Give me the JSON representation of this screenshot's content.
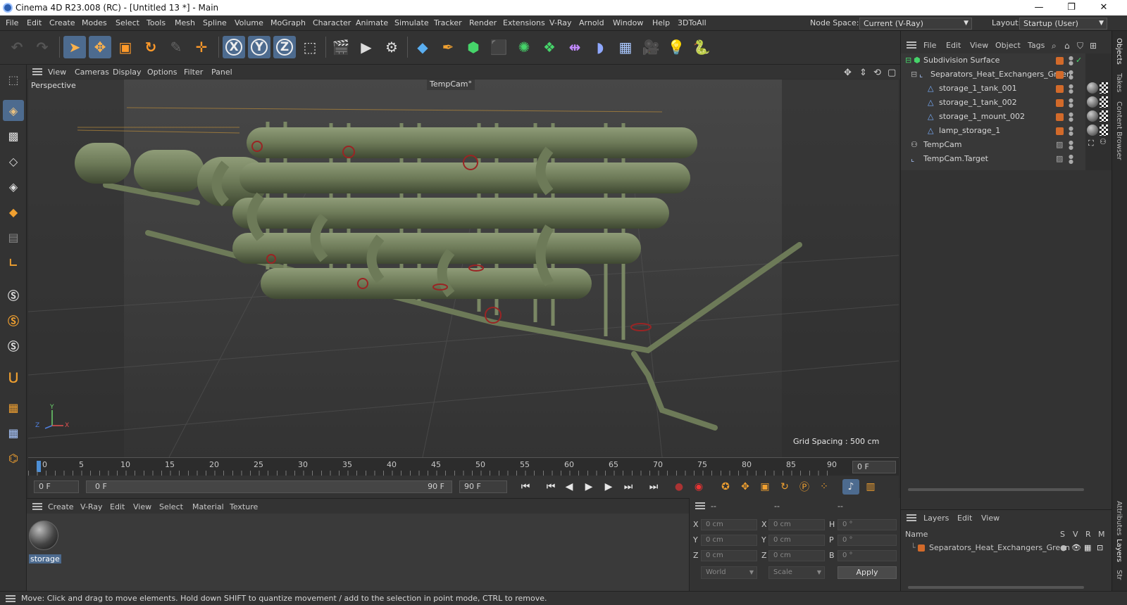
{
  "app": {
    "title": "Cinema 4D R23.008 (RC) - [Untitled 13 *] - Main",
    "window_controls": [
      "—",
      "❐",
      "✕"
    ]
  },
  "menubar": {
    "items": [
      "File",
      "Edit",
      "Create",
      "Modes",
      "Select",
      "Tools",
      "Mesh",
      "Spline",
      "Volume",
      "MoGraph",
      "Character",
      "Animate",
      "Simulate",
      "Tracker",
      "Render",
      "Extensions",
      "V-Ray",
      "Arnold",
      "Window",
      "Help",
      "3DToAll"
    ],
    "node_space_label": "Node Space:",
    "node_space_value": "Current (V-Ray)",
    "layout_label": "Layout:",
    "layout_value": "Startup (User)"
  },
  "toolbar": {
    "axis_labels": [
      "X",
      "Y",
      "Z"
    ]
  },
  "viewport": {
    "menu": [
      "View",
      "Cameras",
      "Display",
      "Options",
      "Filter",
      "Panel"
    ],
    "view_name": "Perspective",
    "camera_name": "TempCam",
    "grid_spacing": "Grid Spacing : 500 cm",
    "axis_x": "X",
    "axis_y": "Y",
    "axis_z": "Z"
  },
  "timeline": {
    "ticks": [
      "0",
      "5",
      "10",
      "15",
      "20",
      "25",
      "30",
      "35",
      "40",
      "45",
      "50",
      "55",
      "60",
      "65",
      "70",
      "75",
      "80",
      "85",
      "90"
    ],
    "current_frame": "0 F",
    "start_frame": "0 F",
    "range_start": "0 F",
    "range_end": "90 F",
    "end_frame": "90 F"
  },
  "material_manager": {
    "menu": [
      "Create",
      "V-Ray",
      "Edit",
      "View",
      "Select",
      "Material",
      "Texture"
    ],
    "materials": [
      {
        "name": "storage"
      }
    ]
  },
  "coordinates": {
    "headers": [
      "--",
      "--",
      "--"
    ],
    "rows": [
      {
        "l1": "X",
        "v1": "0 cm",
        "l2": "X",
        "v2": "0 cm",
        "l3": "H",
        "v3": "0 °"
      },
      {
        "l1": "Y",
        "v1": "0 cm",
        "l2": "Y",
        "v2": "0 cm",
        "l3": "P",
        "v3": "0 °"
      },
      {
        "l1": "Z",
        "v1": "0 cm",
        "l2": "Z",
        "v2": "0 cm",
        "l3": "B",
        "v3": "0 °"
      }
    ],
    "world": "World",
    "scale": "Scale",
    "apply": "Apply"
  },
  "object_manager": {
    "menu": [
      "File",
      "Edit",
      "View",
      "Object",
      "Tags"
    ],
    "objects": [
      {
        "name": "Subdivision Surface"
      },
      {
        "name": "Separators_Heat_Exchangers_Green"
      },
      {
        "name": "storage_1_tank_001"
      },
      {
        "name": "storage_1_tank_002"
      },
      {
        "name": "storage_1_mount_002"
      },
      {
        "name": "lamp_storage_1"
      },
      {
        "name": "TempCam"
      },
      {
        "name": "TempCam.Target"
      }
    ]
  },
  "layer_manager": {
    "menu": [
      "Layers",
      "Edit",
      "View"
    ],
    "col_name": "Name",
    "cols": [
      "S",
      "V",
      "R",
      "M"
    ],
    "layers": [
      {
        "name": "Separators_Heat_Exchangers_Green"
      }
    ]
  },
  "right_tabs": [
    "Objects",
    "Takes",
    "Content Browser",
    "Attributes",
    "Layers",
    "Str"
  ],
  "status": "Move: Click and drag to move elements. Hold down SHIFT to quantize movement / add to the selection in point mode, CTRL to remove.",
  "colors": {
    "accent": "#4d6b8f",
    "tag_orange": "#d26a2a",
    "model_green": "#6d7a58"
  }
}
